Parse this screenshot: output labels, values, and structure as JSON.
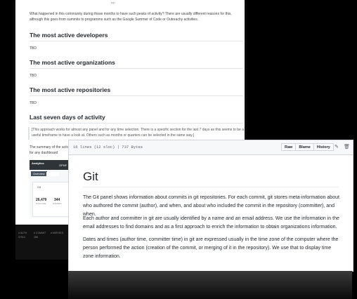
{
  "back_doc": {
    "top_text": "top",
    "intro": "What happened in this community during those months to have such peaks of activity? There are usually different reasons for this, although this goes from summits to programms such as the Google Summer of Code or Outreachy activities.",
    "sections": [
      {
        "heading": "The most active developers",
        "body": "TBD"
      },
      {
        "heading": "The most active organizations",
        "body": "TBD"
      },
      {
        "heading": "The most active repositories",
        "body": "TBD"
      },
      {
        "heading": "Last seven days of activity",
        "body": ""
      }
    ],
    "approach_note": "[This approach works for almost any panel and for any time selection. There is a specific section for the last 7 days as this seems to be a useful timeframe to have a look at. Others such as months or quarters can be selected in the same way.]",
    "summary": "The summary of the activity panel for any dashboard",
    "dashboard": {
      "logo": "Analytics",
      "header_text": "OPNF",
      "overview_tab": "Overview",
      "panel_label": "Git",
      "metrics": [
        {
          "value": "26,479",
          "label": "# Commits"
        },
        {
          "value": "344",
          "label": "# Authors"
        },
        {
          "value": "#",
          "label": "# Repo"
        }
      ]
    },
    "below_rows": [
      {
        "a": "# AUTH",
        "b": "# COMMIT",
        "c": "# MERGES"
      },
      {
        "a": "37514",
        "b": "288",
        "c": ""
      }
    ]
  },
  "file_view": {
    "file_info": "16 lines (12 sloc)  |  737 Bytes",
    "buttons": {
      "raw": "Raw",
      "blame": "Blame",
      "history": "History"
    },
    "title": "Git",
    "paragraphs": [
      "The Git panel shows information about commits in git repositories. For each commit, git stores meta-information about who authored the commit (author), and when, and about who included the commit in the repository (committer), and when.",
      "Each author and committer in git are usually identified by a name and an email address. We use the information in the email addresses to find domains and as a first approach to enrich the information to obtain organizations information.",
      "Dates and times (author time, committer time) in git are expressed usually in the time zone of the computer where the person performed the action (creation of the commit, or merging of it in the repository). We use that to display time zone information."
    ]
  }
}
